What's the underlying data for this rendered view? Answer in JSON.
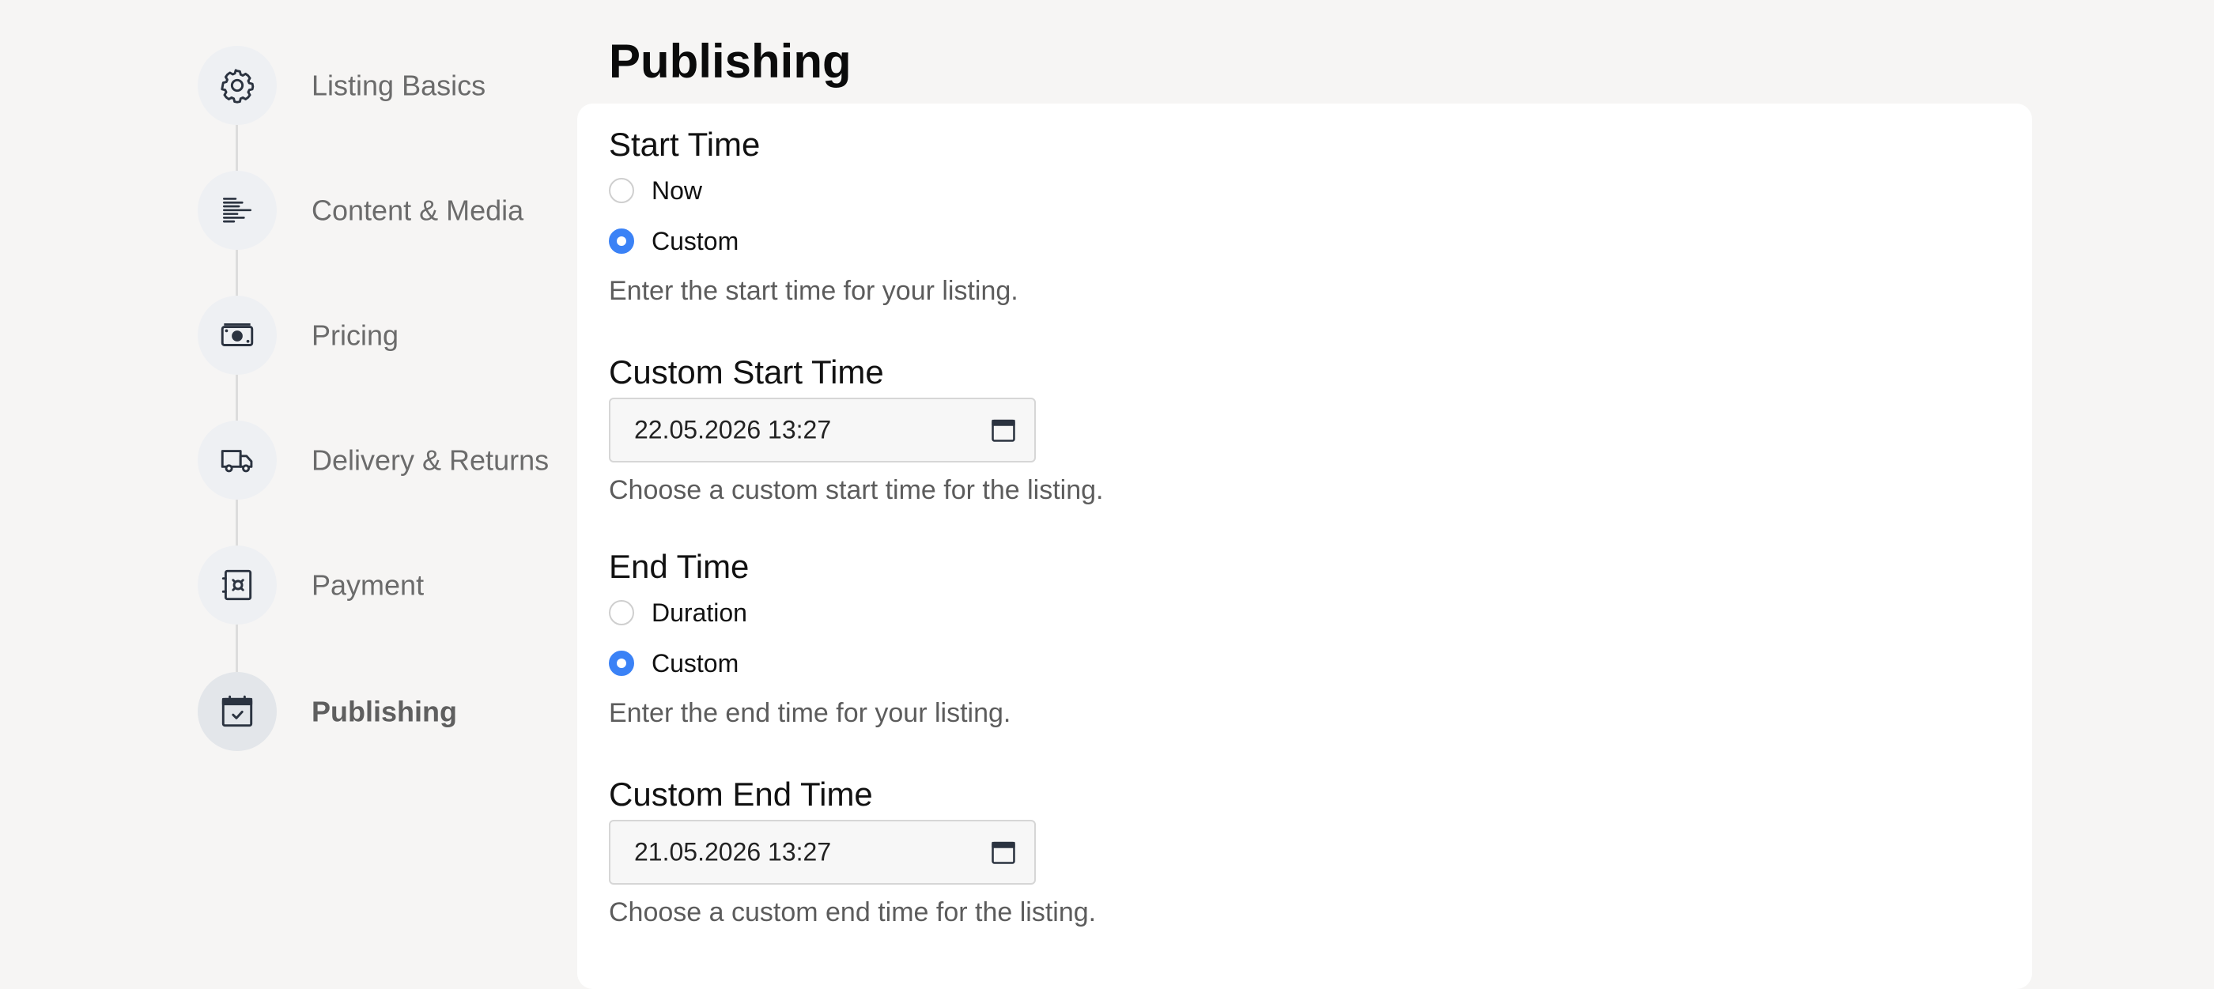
{
  "steps": [
    {
      "label": "Listing Basics",
      "icon": "gear-icon"
    },
    {
      "label": "Content & Media",
      "icon": "text-lines-icon"
    },
    {
      "label": "Pricing",
      "icon": "banknote-icon"
    },
    {
      "label": "Delivery & Returns",
      "icon": "truck-icon"
    },
    {
      "label": "Payment",
      "icon": "safe-icon"
    },
    {
      "label": "Publishing",
      "icon": "calendar-check-icon",
      "active": true
    }
  ],
  "page": {
    "title": "Publishing"
  },
  "start_time": {
    "label": "Start Time",
    "options": [
      "Now",
      "Custom"
    ],
    "selected": "Custom",
    "help": "Enter the start time for your listing."
  },
  "custom_start": {
    "label": "Custom Start Time",
    "value": "22.05.2026 13:27",
    "icon": "calendar-icon",
    "help": "Choose a custom start time for the listing."
  },
  "end_time": {
    "label": "End Time",
    "options": [
      "Duration",
      "Custom"
    ],
    "selected": "Custom",
    "help": "Enter the end time for your listing."
  },
  "custom_end": {
    "label": "Custom End Time",
    "value": "21.05.2026 13:27",
    "icon": "calendar-icon",
    "help": "Choose a custom end time for the listing."
  },
  "colors": {
    "accent": "#3b82f6",
    "background": "#f6f5f4",
    "card": "#ffffff",
    "icon": "#2b3340"
  }
}
